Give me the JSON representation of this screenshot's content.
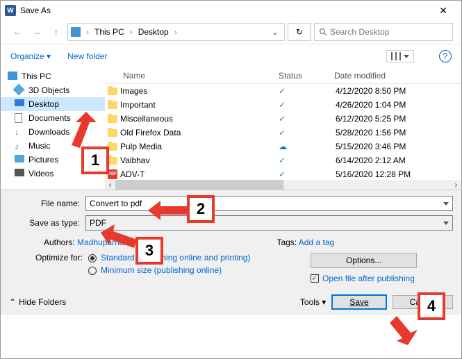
{
  "title": "Save As",
  "nav": {
    "crumb1": "This PC",
    "crumb2": "Desktop",
    "search_placeholder": "Search Desktop"
  },
  "cmdbar": {
    "organize": "Organize",
    "newfolder": "New folder"
  },
  "sidebar": {
    "items": [
      {
        "label": "This PC",
        "icon": "pc",
        "root": true
      },
      {
        "label": "3D Objects",
        "icon": "3d"
      },
      {
        "label": "Desktop",
        "icon": "desktop",
        "selected": true
      },
      {
        "label": "Documents",
        "icon": "doc"
      },
      {
        "label": "Downloads",
        "icon": "down"
      },
      {
        "label": "Music",
        "icon": "music"
      },
      {
        "label": "Pictures",
        "icon": "pic"
      },
      {
        "label": "Videos",
        "icon": "vid"
      }
    ]
  },
  "cols": {
    "name": "Name",
    "status": "Status",
    "date": "Date modified"
  },
  "files": [
    {
      "name": "Images",
      "type": "folder",
      "status": "✓",
      "date": "4/12/2020 8:50 PM"
    },
    {
      "name": "Important",
      "type": "folder",
      "status": "✓",
      "date": "4/26/2020 1:04 PM"
    },
    {
      "name": "Miscellaneous",
      "type": "folder",
      "status": "✓",
      "date": "6/12/2020 5:25 PM"
    },
    {
      "name": "Old Firefox Data",
      "type": "folder",
      "status": "✓",
      "date": "5/28/2020 1:56 PM"
    },
    {
      "name": "Pulp Media",
      "type": "folder",
      "status": "☁",
      "statusColor": "blue",
      "date": "5/15/2020 3:46 PM"
    },
    {
      "name": "Vaibhav",
      "type": "folder",
      "status": "✓",
      "date": "6/14/2020 2:12 AM"
    },
    {
      "name": "ADV-T",
      "type": "pdf",
      "status": "✓",
      "date": "5/16/2020 12:28 PM"
    }
  ],
  "filename_label": "File name:",
  "filename_value": "Convert to pdf",
  "savetype_label": "Save as type:",
  "savetype_value": "PDF",
  "authors_label": "Authors:",
  "authors_value": "Madhuparna",
  "tags_label": "Tags:",
  "tags_value": "Add a tag",
  "optimize_label": "Optimize for:",
  "opt1": "Standard (publishing online and printing)",
  "opt2": "Minimum size (publishing online)",
  "options_btn": "Options...",
  "openafter": "Open file after publishing",
  "hidefolders": "Hide Folders",
  "tools": "Tools",
  "save": "Save",
  "cancel": "Cancel",
  "callouts": {
    "c1": "1",
    "c2": "2",
    "c3": "3",
    "c4": "4"
  }
}
